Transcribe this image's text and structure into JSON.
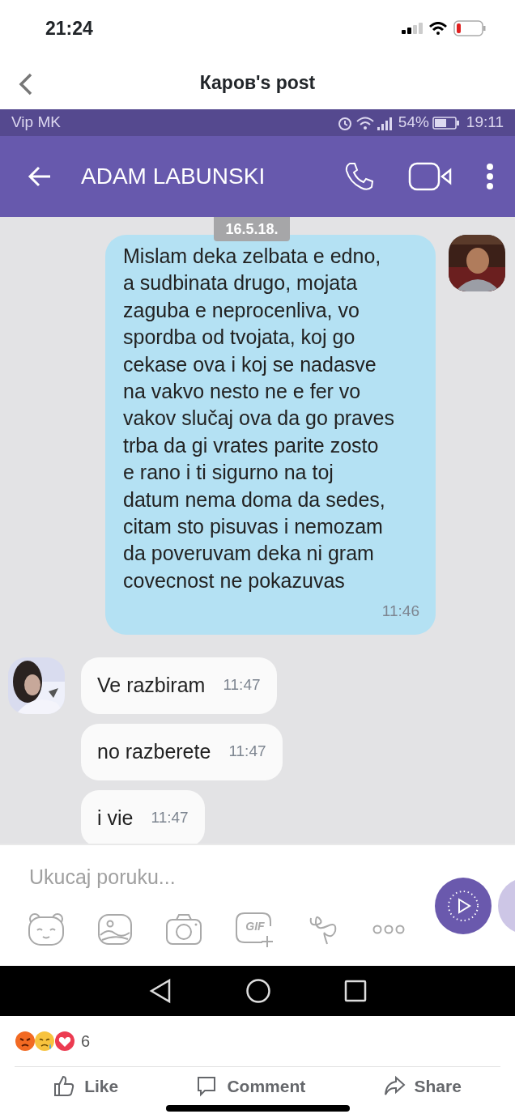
{
  "ios_status": {
    "time": "21:24"
  },
  "nav": {
    "title": "Каров's post"
  },
  "screenshot": {
    "status_bar": {
      "carrier": "Vip MK",
      "battery": "54%",
      "time": "19:11"
    },
    "header": {
      "contact": "ADAM LABUNSKI"
    },
    "date": "16.5.18.",
    "messages": [
      {
        "kind": "outgoing",
        "text": "Mislam deka zelbata e edno,\na sudbinata drugo, mojata\nzaguba e neprocenliva, vo\nspordba od tvojata, koj go\ncekase ova i koj se nadasve\nna vakvo nesto ne e fer vo\nvakov slučaj ova da go praves\ntrba da gi vrates parite zosto\ne rano i ti sigurno na toj\ndatum nema doma da sedes,\ncitam sto pisuvas i nemozam\nda poveruvam deka ni gram\ncovecnost ne pokazuvas",
        "time": "11:46",
        "avatar": true
      },
      {
        "kind": "incoming",
        "text": "Ve razbiram",
        "time": "11:47",
        "avatar": true
      },
      {
        "kind": "incoming",
        "text": "no razberete",
        "time": "11:47",
        "avatar": false
      },
      {
        "kind": "incoming",
        "text": "i vie",
        "time": "11:47",
        "avatar": false
      }
    ],
    "composer": {
      "placeholder": "Ukucaj poruku...",
      "gif_label": "GIF"
    }
  },
  "post": {
    "reaction_count": "6",
    "actions": [
      {
        "kind": "like",
        "label": "Like"
      },
      {
        "kind": "comment",
        "label": "Comment"
      },
      {
        "kind": "share",
        "label": "Share"
      }
    ]
  }
}
